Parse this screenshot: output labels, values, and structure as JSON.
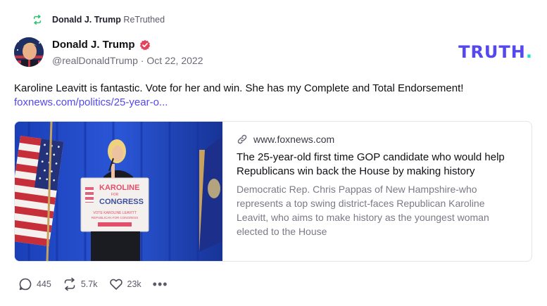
{
  "retruth": {
    "icon": "retruth-icon",
    "name": "Donald J. Trump",
    "label": "ReTruthed"
  },
  "author": {
    "avatar_icon": "avatar-image",
    "name": "Donald J. Trump",
    "verified_icon": "verified-badge-icon",
    "handle": "@realDonaldTrump",
    "separator": "·",
    "date": "Oct 22, 2022"
  },
  "brand": {
    "logo_text": "TRUTH",
    "logo_dot": ".",
    "accent_color": "#5448ee",
    "dot_color": "#17e3c2"
  },
  "post": {
    "text": "Karoline Leavitt is fantastic. Vote for her and win. She has my Complete and Total Endorsement!",
    "link": "foxnews.com/politics/25-year-o..."
  },
  "card": {
    "image_sign": {
      "line1": "KAROLINE",
      "line2": "FOR",
      "line3": "CONGRESS",
      "line4": "VOTE KAROLINE LEAVITT",
      "line5": "REPUBLICAN FOR CONGRESS"
    },
    "domain": "www.foxnews.com",
    "title": "The 25-year-old first time GOP candidate who would help Republicans win back the House by making history",
    "description": "Democratic Rep. Chris Pappas of New Hampshire-who represents a top swing district-faces Republican Karoline Leavitt, who aims to make history as the youngest woman elected to the House"
  },
  "actions": {
    "replies": "445",
    "retruths": "5.7k",
    "likes": "23k",
    "more": "•••"
  }
}
